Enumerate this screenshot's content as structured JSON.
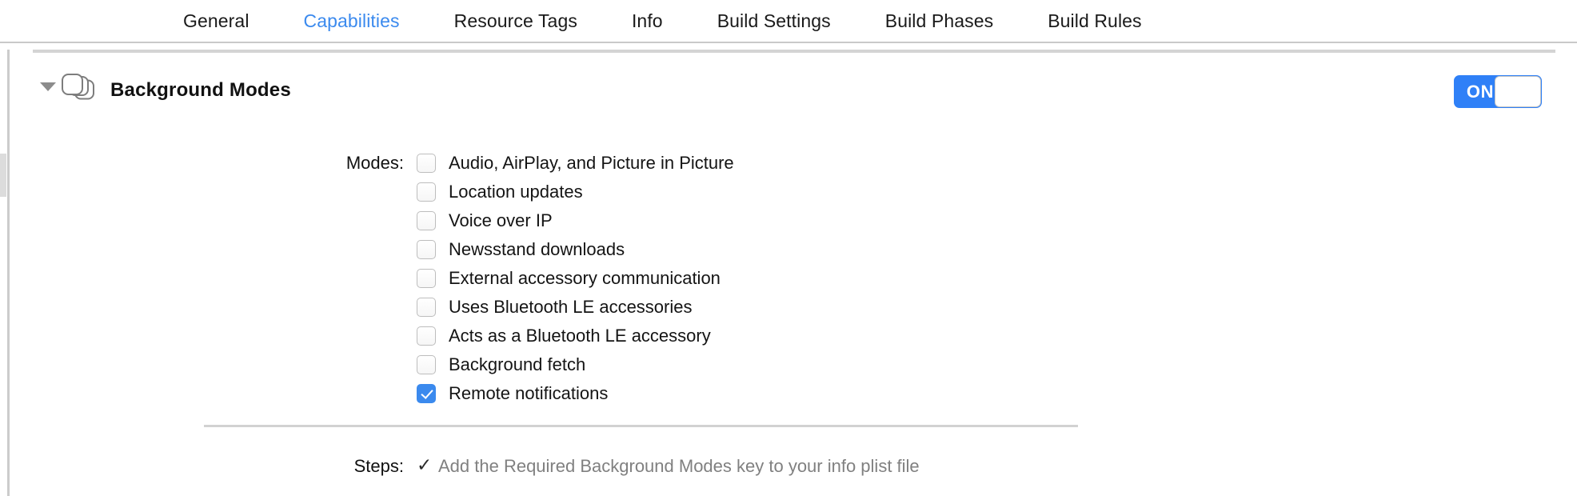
{
  "tabs": [
    {
      "label": "General",
      "active": false
    },
    {
      "label": "Capabilities",
      "active": true
    },
    {
      "label": "Resource Tags",
      "active": false
    },
    {
      "label": "Info",
      "active": false
    },
    {
      "label": "Build Settings",
      "active": false
    },
    {
      "label": "Build Phases",
      "active": false
    },
    {
      "label": "Build Rules",
      "active": false
    }
  ],
  "capability": {
    "title": "Background Modes",
    "icon": "stacked-cards-icon",
    "disclosure": "triangle-down-icon",
    "expanded": true,
    "toggle": {
      "state": "ON",
      "label": "ON",
      "on_color": "#2f80f7",
      "knob_color": "#ffffff"
    }
  },
  "modes": {
    "label": "Modes:",
    "items": [
      {
        "label": "Audio, AirPlay, and Picture in Picture",
        "checked": false
      },
      {
        "label": "Location updates",
        "checked": false
      },
      {
        "label": "Voice over IP",
        "checked": false
      },
      {
        "label": "Newsstand downloads",
        "checked": false
      },
      {
        "label": "External accessory communication",
        "checked": false
      },
      {
        "label": "Uses Bluetooth LE accessories",
        "checked": false
      },
      {
        "label": "Acts as a Bluetooth LE accessory",
        "checked": false
      },
      {
        "label": "Background fetch",
        "checked": false
      },
      {
        "label": "Remote notifications",
        "checked": true
      }
    ]
  },
  "steps": {
    "label": "Steps:",
    "check_glyph": "✓",
    "text": "Add the Required Background Modes key to your info plist file"
  },
  "colors": {
    "accent": "#3b8aee",
    "toggle_on": "#2f80f7",
    "muted_text": "#808080",
    "rule": "#d2d2d2"
  }
}
